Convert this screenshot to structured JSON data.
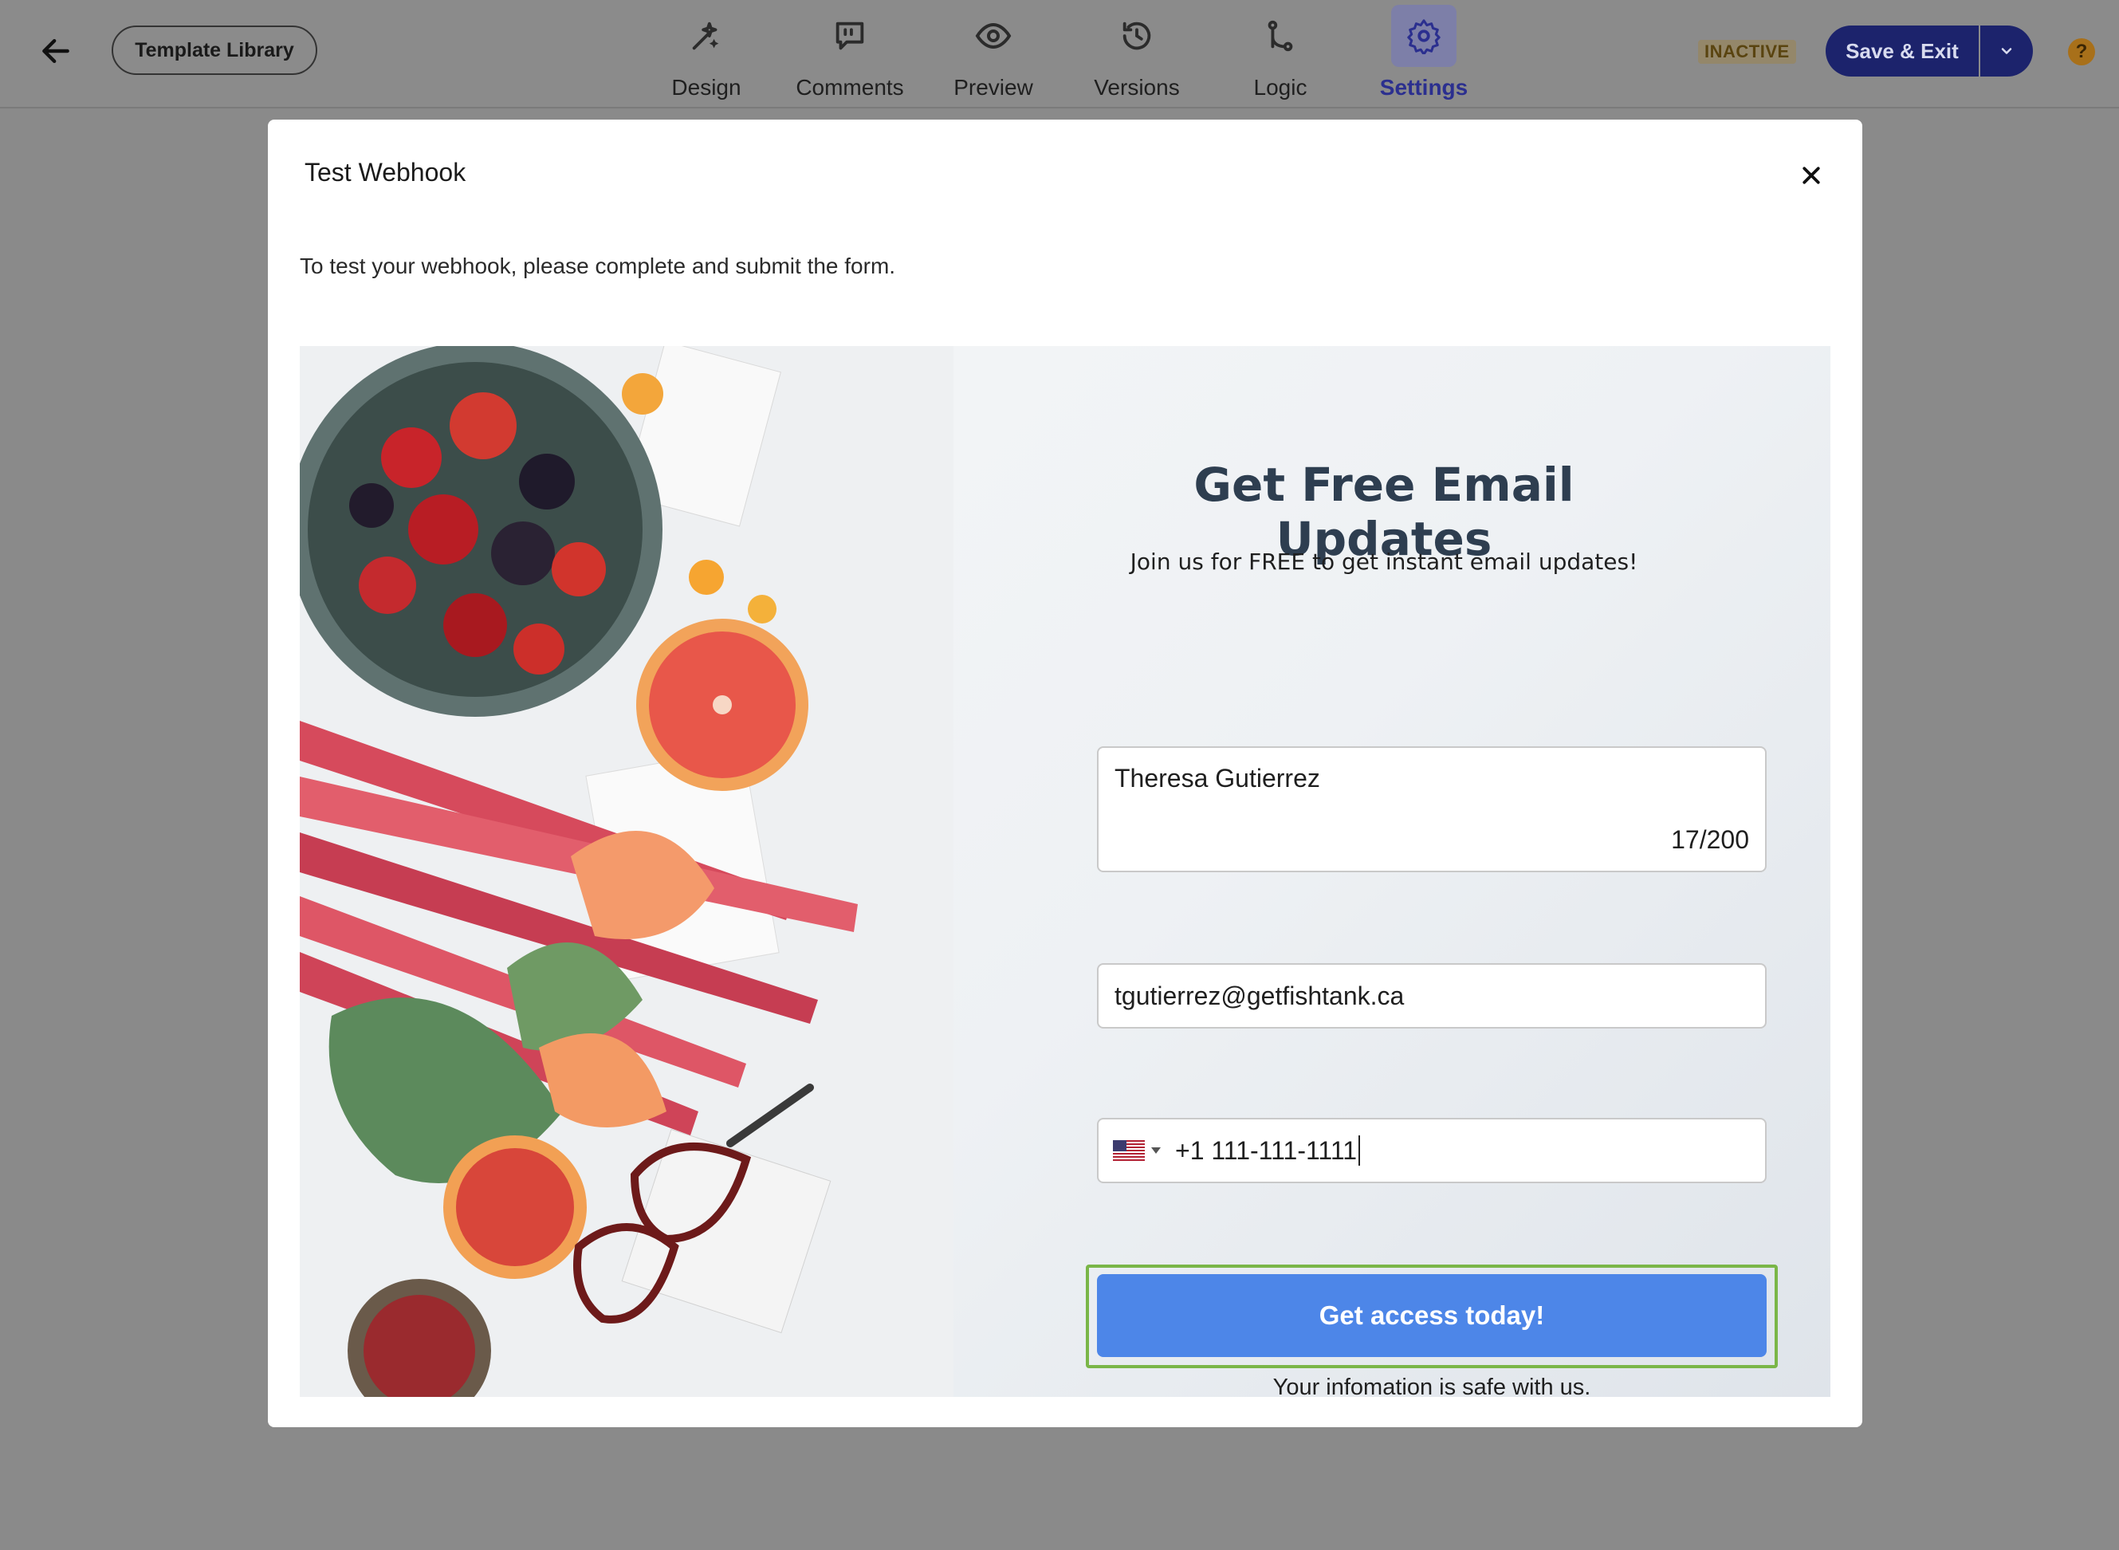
{
  "header": {
    "template_library_label": "Template Library",
    "nav": [
      {
        "label": "Design",
        "icon": "design-icon"
      },
      {
        "label": "Comments",
        "icon": "comments-icon"
      },
      {
        "label": "Preview",
        "icon": "eye-icon"
      },
      {
        "label": "Versions",
        "icon": "history-icon"
      },
      {
        "label": "Logic",
        "icon": "logic-branch-icon"
      },
      {
        "label": "Settings",
        "icon": "gear-icon",
        "active": true
      }
    ],
    "status": "INACTIVE",
    "save_label": "Save & Exit",
    "help_glyph": "?"
  },
  "modal": {
    "title": "Test Webhook",
    "description": "To test your webhook, please complete and submit the form.",
    "form": {
      "title": "Get Free Email Updates",
      "subtitle": "Join us for FREE to get instant email updates!",
      "name_value": "Theresa Gutierrez",
      "name_counter": "17/200",
      "email_value": "tgutierrez@getfishtank.ca",
      "phone_country": "US",
      "phone_value": "+1 111-111-1111",
      "submit_label": "Get access today!",
      "note": "Your infomation is safe with us."
    }
  },
  "colors": {
    "accent": "#1c236c",
    "settings_active": "#2b2f8f",
    "cta": "#4d86e8",
    "focus_ring": "#7ab648",
    "status_badge": "#94876a"
  }
}
